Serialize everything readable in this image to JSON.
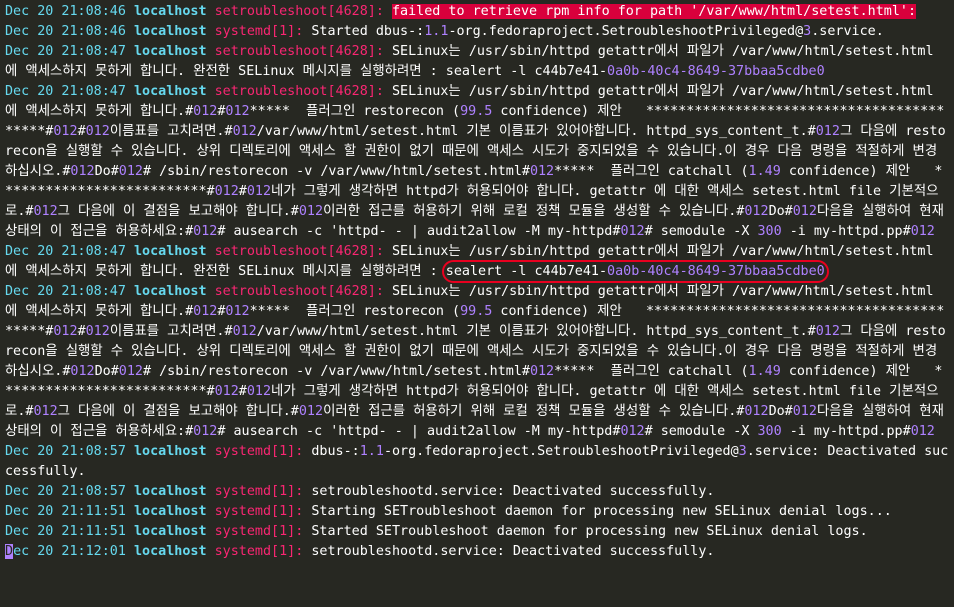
{
  "lines": [
    [
      {
        "t": "Dec 20 21:08:46 ",
        "c": "ts"
      },
      {
        "t": "localhost ",
        "c": "host"
      },
      {
        "t": "setroubleshoot[4628]:",
        "c": "proc"
      },
      {
        "t": " "
      },
      {
        "t": "failed to retrieve rpm info for path '/var/www/html/setest.html':",
        "c": "err"
      }
    ],
    [
      {
        "t": "Dec 20 21:08:46 ",
        "c": "ts"
      },
      {
        "t": "localhost ",
        "c": "host"
      },
      {
        "t": "systemd[1]:",
        "c": "proc"
      },
      {
        "t": " Started dbus-:"
      },
      {
        "t": "1.1",
        "c": "num"
      },
      {
        "t": "-org.fedoraproject.SetroubleshootPrivileged@"
      },
      {
        "t": "3",
        "c": "num"
      },
      {
        "t": ".service."
      }
    ],
    [
      {
        "t": "Dec 20 21:08:47 ",
        "c": "ts"
      },
      {
        "t": "localhost ",
        "c": "host"
      },
      {
        "t": "setroubleshoot[4628]:",
        "c": "proc"
      },
      {
        "t": " SELinux는 /usr/sbin/httpd getattr에서 파일가 /var/www/html/setest.html 에 액세스하지 못하게 합니다. 완전한 SELinux 메시지를 실행하려면 : sealert -l c44b7e41-"
      },
      {
        "t": "0a0b-40c4-8649-37bbaa5cdbe0",
        "c": "num"
      }
    ],
    [
      {
        "t": "Dec 20 21:08:47 ",
        "c": "ts"
      },
      {
        "t": "localhost ",
        "c": "host"
      },
      {
        "t": "setroubleshoot[4628]:",
        "c": "proc"
      },
      {
        "t": " SELinux는 /usr/sbin/httpd getattr에서 파일가 /var/www/html/setest.html 에 액세스하지 못하게 합니다.#"
      },
      {
        "t": "012",
        "c": "num"
      },
      {
        "t": "#"
      },
      {
        "t": "012",
        "c": "num"
      },
      {
        "t": "*****  플러그인 restorecon ("
      },
      {
        "t": "99.5",
        "c": "num"
      },
      {
        "t": " confidence) 제안   ******************************************#"
      },
      {
        "t": "012",
        "c": "num"
      },
      {
        "t": "#"
      },
      {
        "t": "012",
        "c": "num"
      },
      {
        "t": "이름표를 고치려면.#"
      },
      {
        "t": "012",
        "c": "num"
      },
      {
        "t": "/var/www/html/setest.html 기본 이름표가 있어야합니다. httpd_sys_content_t.#"
      },
      {
        "t": "012",
        "c": "num"
      },
      {
        "t": "그 다음에 restorecon을 실행할 수 있습니다. 상위 디렉토리에 액세스 할 권한이 없기 때문에 액세스 시도가 중지되었을 수 있습니다.이 경우 다음 명령을 적절하게 변경하십시오.#"
      },
      {
        "t": "012",
        "c": "num"
      },
      {
        "t": "Do#"
      },
      {
        "t": "012",
        "c": "num"
      },
      {
        "t": "# /sbin/restorecon -v /var/www/html/setest.html#"
      },
      {
        "t": "012",
        "c": "num"
      },
      {
        "t": "*****  플러그인 catchall ("
      },
      {
        "t": "1.49",
        "c": "num"
      },
      {
        "t": " confidence) 제안   **************************#"
      },
      {
        "t": "012",
        "c": "num"
      },
      {
        "t": "#"
      },
      {
        "t": "012",
        "c": "num"
      },
      {
        "t": "네가 그렇게 생각하면 httpd가 허용되어야 합니다. getattr 에 대한 액세스 setest.html file 기본적으로.#"
      },
      {
        "t": "012",
        "c": "num"
      },
      {
        "t": "그 다음에 이 결점을 보고해야 합니다.#"
      },
      {
        "t": "012",
        "c": "num"
      },
      {
        "t": "이러한 접근를 허용하기 위해 로컬 정책 모듈을 생성할 수 있습니다.#"
      },
      {
        "t": "012",
        "c": "num"
      },
      {
        "t": "Do#"
      },
      {
        "t": "012",
        "c": "num"
      },
      {
        "t": "다음을 실행하여 현재상태의 이 접근을 허용하세요:#"
      },
      {
        "t": "012",
        "c": "num"
      },
      {
        "t": "# ausearch -c 'httpd- - | audit2allow -M my-httpd#"
      },
      {
        "t": "012",
        "c": "num"
      },
      {
        "t": "# semodule -X "
      },
      {
        "t": "300",
        "c": "num"
      },
      {
        "t": " -i my-httpd.pp#"
      },
      {
        "t": "012",
        "c": "num"
      }
    ],
    [
      {
        "t": "Dec 20 21:08:47 ",
        "c": "ts"
      },
      {
        "t": "localhost ",
        "c": "host"
      },
      {
        "t": "setroubleshoot[4628]:",
        "c": "proc"
      },
      {
        "t": " SELinux는 /usr/sbin/httpd getattr에서 파일가 /var/www/html/setest.html 에 액세스하지 못하게 합니다. 완전한 SELinux 메시지를 실행하려면 : "
      },
      {
        "t": "sealert -l c44b7e41-",
        "c": "circ"
      },
      {
        "t": "0a0b-40c4-8649-37bbaa5cdbe0",
        "c": "circnum"
      }
    ],
    [
      {
        "t": "Dec 20 21:08:47 ",
        "c": "ts"
      },
      {
        "t": "localhost ",
        "c": "host"
      },
      {
        "t": "setroubleshoot[4628]:",
        "c": "proc"
      },
      {
        "t": " SELinux는 /usr/sbin/httpd getattr에서 파일가 /var/www/html/setest.html 에 액세스하지 못하게 합니다.#"
      },
      {
        "t": "012",
        "c": "num"
      },
      {
        "t": "#"
      },
      {
        "t": "012",
        "c": "num"
      },
      {
        "t": "*****  플러그인 restorecon ("
      },
      {
        "t": "99.5",
        "c": "num"
      },
      {
        "t": " confidence) 제안   ******************************************#"
      },
      {
        "t": "012",
        "c": "num"
      },
      {
        "t": "#"
      },
      {
        "t": "012",
        "c": "num"
      },
      {
        "t": "이름표를 고치려면.#"
      },
      {
        "t": "012",
        "c": "num"
      },
      {
        "t": "/var/www/html/setest.html 기본 이름표가 있어야합니다. httpd_sys_content_t.#"
      },
      {
        "t": "012",
        "c": "num"
      },
      {
        "t": "그 다음에 restorecon을 실행할 수 있습니다. 상위 디렉토리에 액세스 할 권한이 없기 때문에 액세스 시도가 중지되었을 수 있습니다.이 경우 다음 명령을 적절하게 변경하십시오.#"
      },
      {
        "t": "012",
        "c": "num"
      },
      {
        "t": "Do#"
      },
      {
        "t": "012",
        "c": "num"
      },
      {
        "t": "# /sbin/restorecon -v /var/www/html/setest.html#"
      },
      {
        "t": "012",
        "c": "num"
      },
      {
        "t": "*****  플러그인 catchall ("
      },
      {
        "t": "1.49",
        "c": "num"
      },
      {
        "t": " confidence) 제안   **************************#"
      },
      {
        "t": "012",
        "c": "num"
      },
      {
        "t": "#"
      },
      {
        "t": "012",
        "c": "num"
      },
      {
        "t": "네가 그렇게 생각하면 httpd가 허용되어야 합니다. getattr 에 대한 액세스 setest.html file 기본적으로.#"
      },
      {
        "t": "012",
        "c": "num"
      },
      {
        "t": "그 다음에 이 결점을 보고해야 합니다.#"
      },
      {
        "t": "012",
        "c": "num"
      },
      {
        "t": "이러한 접근를 허용하기 위해 로컬 정책 모듈을 생성할 수 있습니다.#"
      },
      {
        "t": "012",
        "c": "num"
      },
      {
        "t": "Do#"
      },
      {
        "t": "012",
        "c": "num"
      },
      {
        "t": "다음을 실행하여 현재상태의 이 접근을 허용하세요:#"
      },
      {
        "t": "012",
        "c": "num"
      },
      {
        "t": "# ausearch -c 'httpd- - | audit2allow -M my-httpd#"
      },
      {
        "t": "012",
        "c": "num"
      },
      {
        "t": "# semodule -X "
      },
      {
        "t": "300",
        "c": "num"
      },
      {
        "t": " -i my-httpd.pp#"
      },
      {
        "t": "012",
        "c": "num"
      }
    ],
    [
      {
        "t": "Dec 20 21:08:57 ",
        "c": "ts"
      },
      {
        "t": "localhost ",
        "c": "host"
      },
      {
        "t": "systemd[1]:",
        "c": "proc"
      },
      {
        "t": " dbus-:"
      },
      {
        "t": "1.1",
        "c": "num"
      },
      {
        "t": "-org.fedoraproject.SetroubleshootPrivileged@"
      },
      {
        "t": "3",
        "c": "num"
      },
      {
        "t": ".service: Deactivated successfully."
      }
    ],
    [
      {
        "t": "Dec 20 21:08:57 ",
        "c": "ts"
      },
      {
        "t": "localhost ",
        "c": "host"
      },
      {
        "t": "systemd[1]:",
        "c": "proc"
      },
      {
        "t": " setroubleshootd.service: Deactivated successfully."
      }
    ],
    [
      {
        "t": "Dec 20 21:11:51 ",
        "c": "ts"
      },
      {
        "t": "localhost ",
        "c": "host"
      },
      {
        "t": "systemd[1]:",
        "c": "proc"
      },
      {
        "t": " Starting SETroubleshoot daemon for processing new SELinux denial logs..."
      }
    ],
    [
      {
        "t": "Dec 20 21:11:51 ",
        "c": "ts"
      },
      {
        "t": "localhost ",
        "c": "host"
      },
      {
        "t": "systemd[1]:",
        "c": "proc"
      },
      {
        "t": " Started SETroubleshoot daemon for processing new SELinux denial logs."
      }
    ],
    [
      {
        "t": "D",
        "c": "cursor"
      },
      {
        "t": "ec 20 21:12:01 ",
        "c": "ts"
      },
      {
        "t": "localhost ",
        "c": "host"
      },
      {
        "t": "systemd[1]:",
        "c": "proc"
      },
      {
        "t": " setroubleshootd.service: Deactivated successfully."
      }
    ]
  ],
  "colors": {
    "background": "#272822",
    "timestamp": "#66d9ef",
    "process": "#f92672",
    "number": "#ae81ff",
    "error_bg": "#d9003c",
    "annotation": "#e8001f"
  }
}
